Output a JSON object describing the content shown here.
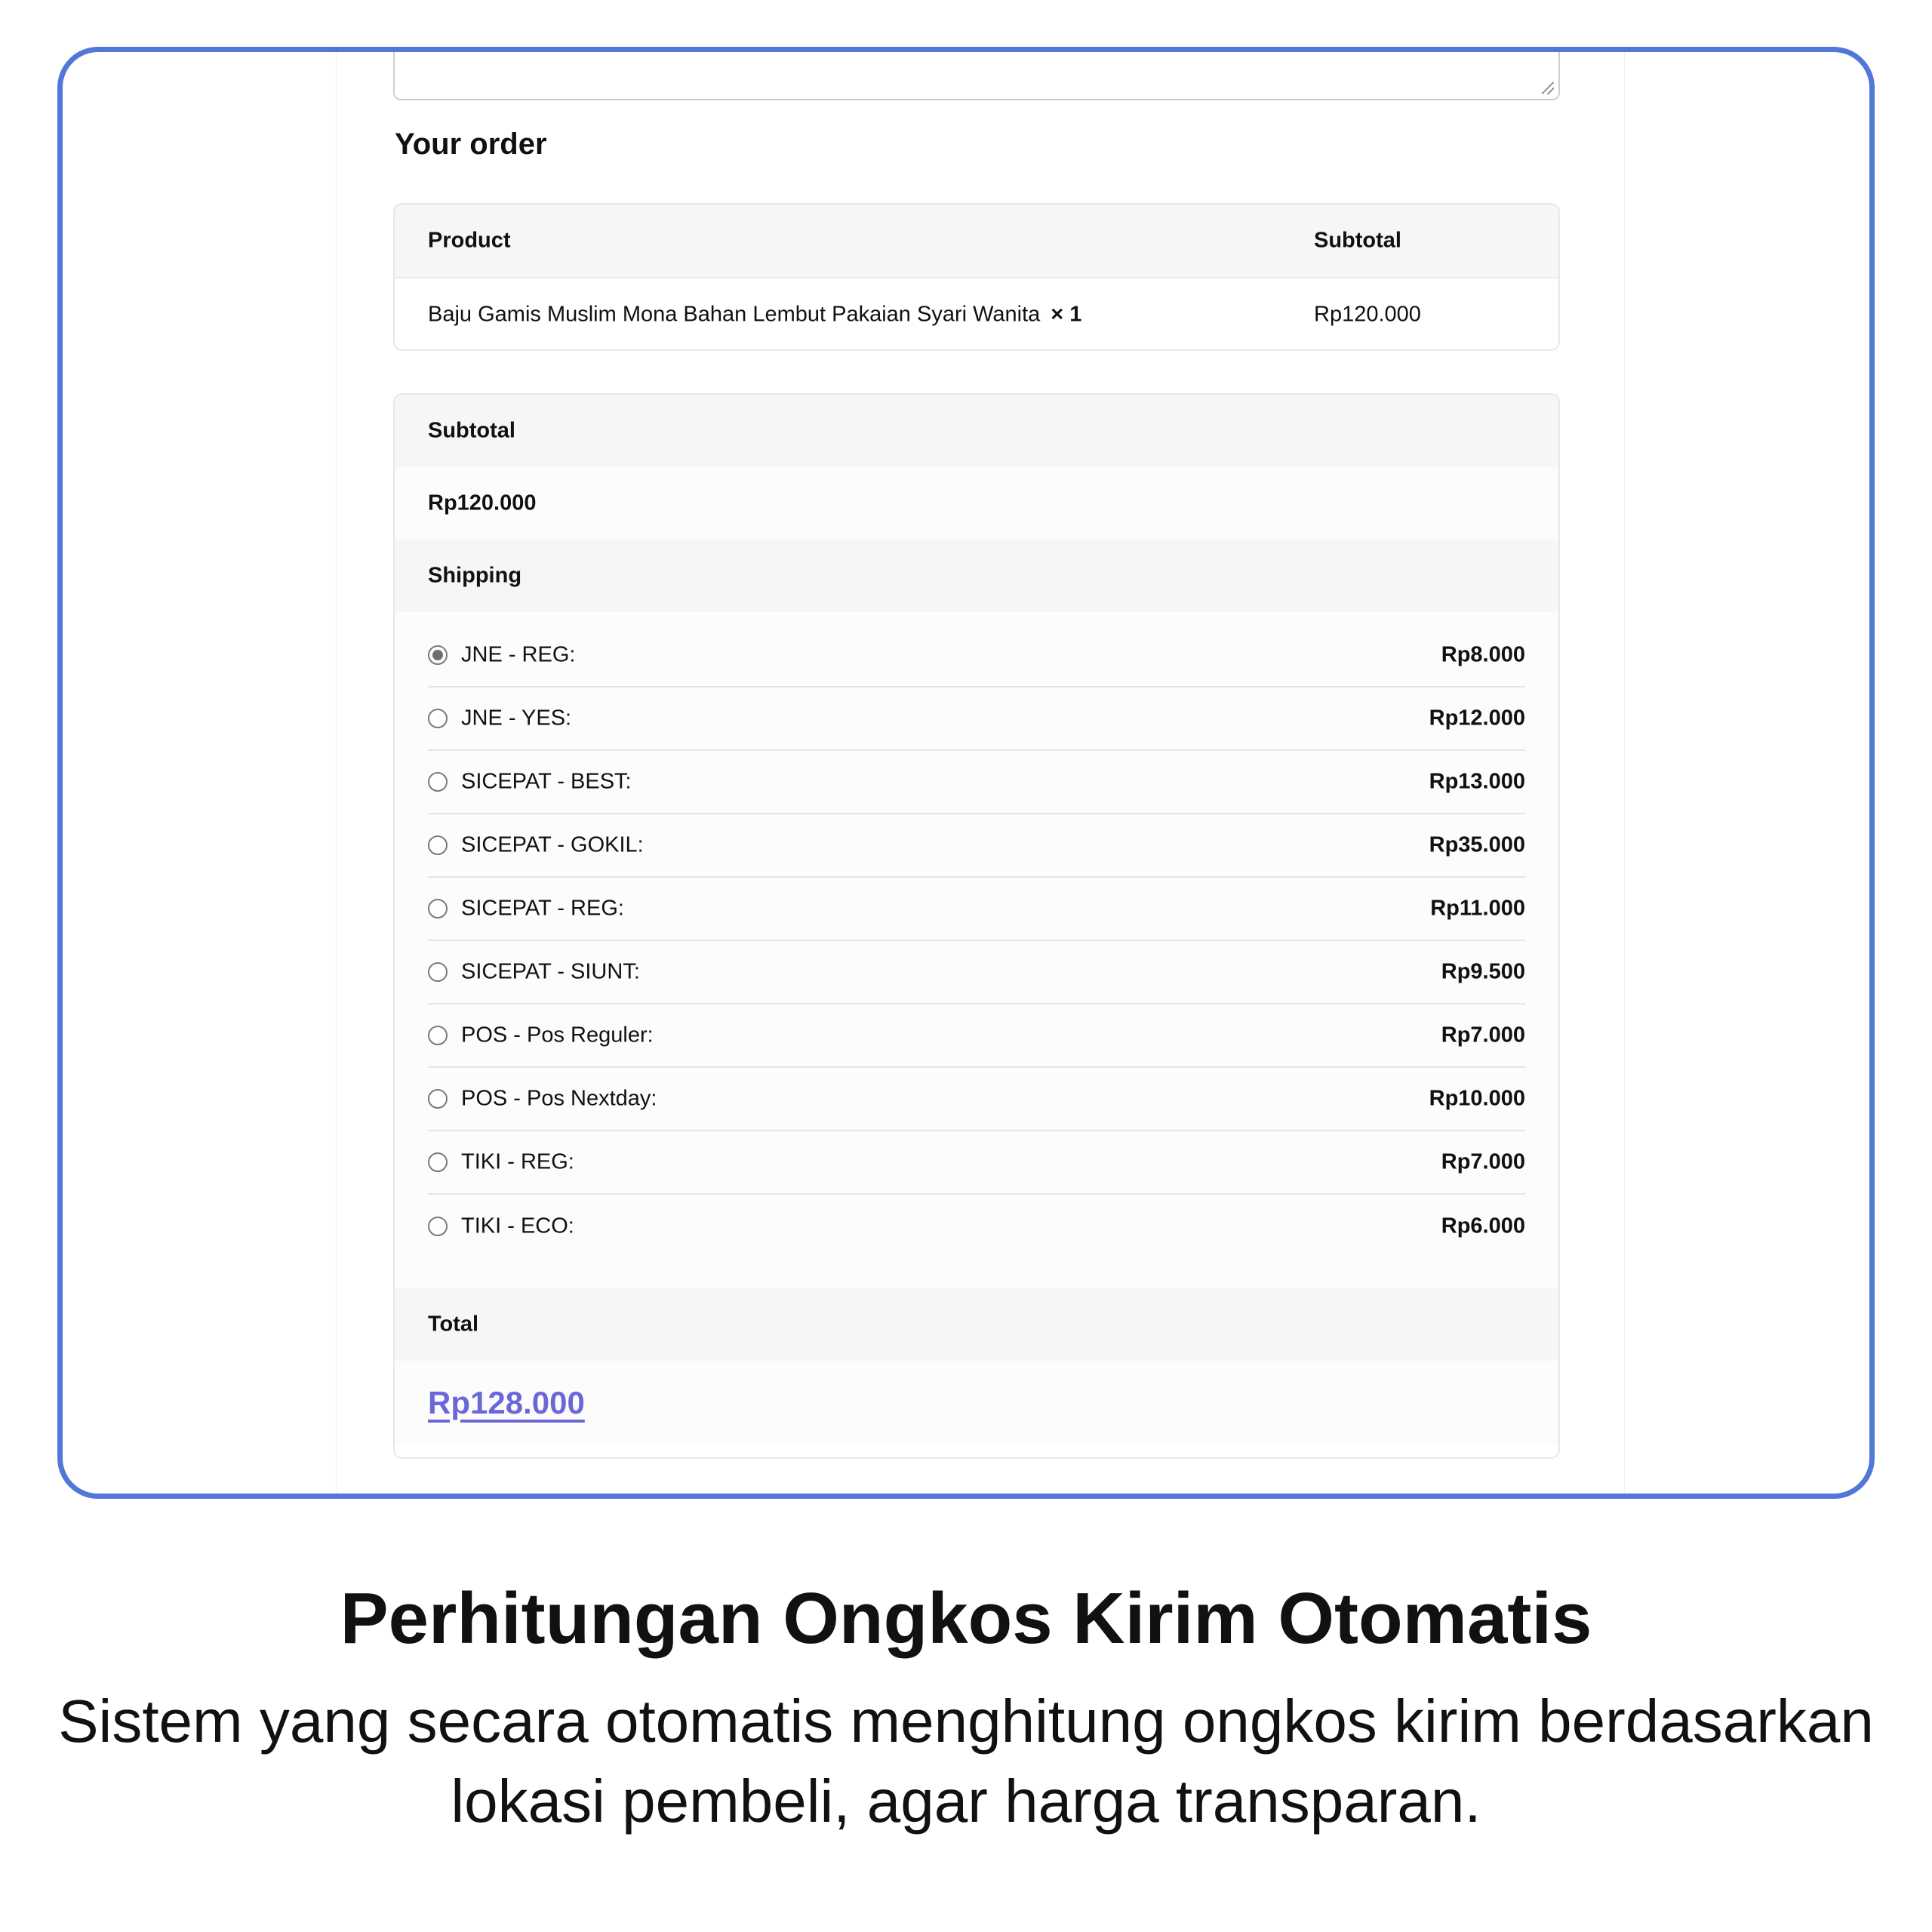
{
  "order": {
    "heading": "Your order",
    "columns": {
      "product": "Product",
      "subtotal": "Subtotal"
    },
    "item": {
      "name": "Baju Gamis Muslim Mona Bahan Lembut Pakaian Syari Wanita",
      "quantity": "× 1",
      "subtotal": "Rp120.000"
    }
  },
  "totals": {
    "subtotal_label": "Subtotal",
    "subtotal_value": "Rp120.000",
    "shipping_label": "Shipping",
    "shipping_options": [
      {
        "label": "JNE - REG:",
        "price": "Rp8.000",
        "selected": true
      },
      {
        "label": "JNE - YES:",
        "price": "Rp12.000",
        "selected": false
      },
      {
        "label": "SICEPAT - BEST:",
        "price": "Rp13.000",
        "selected": false
      },
      {
        "label": "SICEPAT - GOKIL:",
        "price": "Rp35.000",
        "selected": false
      },
      {
        "label": "SICEPAT - REG:",
        "price": "Rp11.000",
        "selected": false
      },
      {
        "label": "SICEPAT - SIUNT:",
        "price": "Rp9.500",
        "selected": false
      },
      {
        "label": "POS - Pos Reguler:",
        "price": "Rp7.000",
        "selected": false
      },
      {
        "label": "POS - Pos Nextday:",
        "price": "Rp10.000",
        "selected": false
      },
      {
        "label": "TIKI - REG:",
        "price": "Rp7.000",
        "selected": false
      },
      {
        "label": "TIKI - ECO:",
        "price": "Rp6.000",
        "selected": false
      }
    ],
    "total_label": "Total",
    "total_value": "Rp128.000"
  },
  "caption": {
    "title": "Perhitungan Ongkos Kirim Otomatis",
    "description": "Sistem yang secara otomatis menghitung ongkos kirim berdasarkan lokasi pembeli, agar harga transparan."
  },
  "colors": {
    "frame_border": "#5178d8",
    "total_link": "#6a68d9"
  }
}
